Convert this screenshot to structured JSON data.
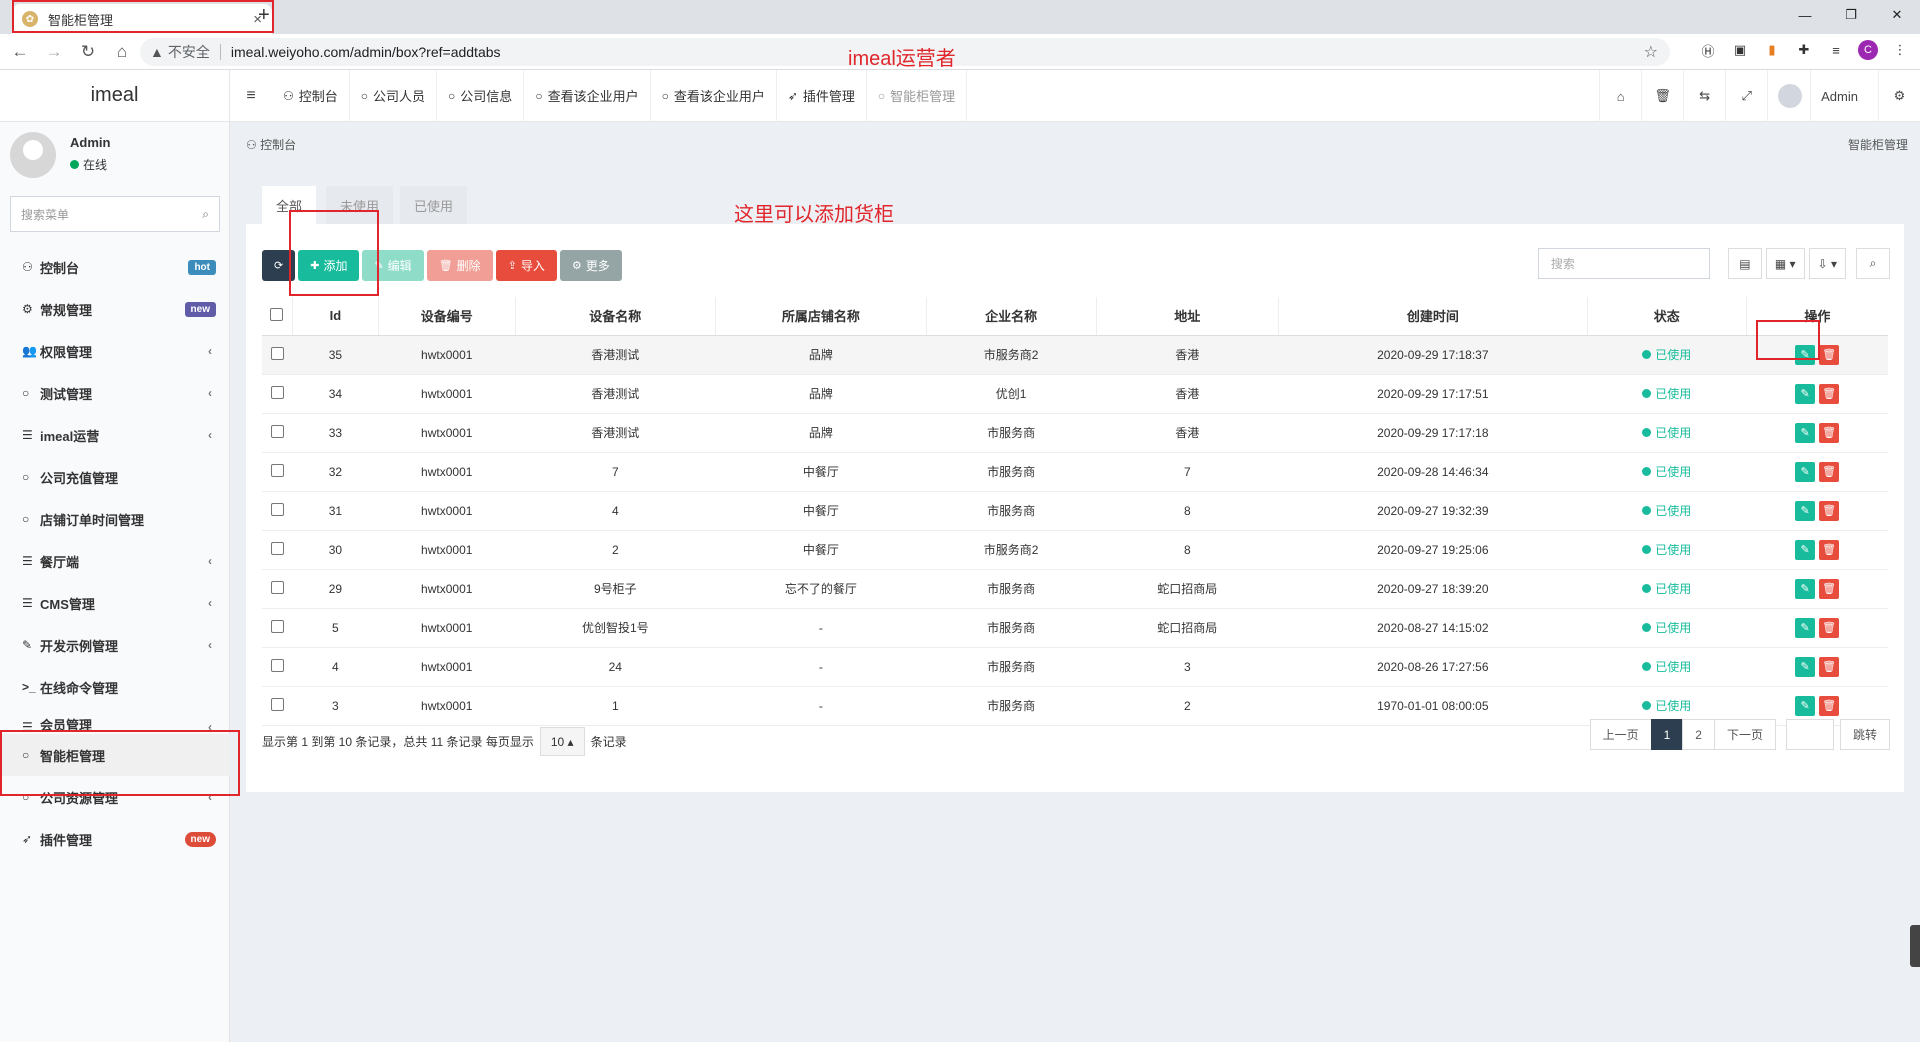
{
  "browser": {
    "tab_title": "智能柜管理",
    "tab_favicon": "imeal-favicon",
    "insecure_label": "不安全",
    "url": "imeal.weiyoho.com/admin/box?ref=addtabs",
    "profile_initial": "C"
  },
  "annotations": {
    "operator_note": "imeal运营者",
    "add_note": "这里可以添加货柜"
  },
  "brand": "imeal",
  "topnav": {
    "items": [
      {
        "icon": "dashboard-icon",
        "label": "控制台"
      },
      {
        "icon": "circle-icon",
        "label": "公司人员"
      },
      {
        "icon": "circle-icon",
        "label": "公司信息"
      },
      {
        "icon": "circle-icon",
        "label": "查看该企业用户"
      },
      {
        "icon": "circle-icon",
        "label": "查看该企业用户"
      },
      {
        "icon": "rocket-icon",
        "label": "插件管理"
      },
      {
        "icon": "circle-icon",
        "label": "智能柜管理"
      }
    ],
    "user": "Admin"
  },
  "sidebar": {
    "user_name": "Admin",
    "status": "在线",
    "search_placeholder": "搜索菜单",
    "items": [
      {
        "label": "控制台",
        "badge": "hot"
      },
      {
        "label": "常规管理",
        "badge": "new"
      },
      {
        "label": "权限管理"
      },
      {
        "label": "测试管理"
      },
      {
        "label": "imeal运营"
      },
      {
        "label": "公司充值管理"
      },
      {
        "label": "店铺订单时间管理"
      },
      {
        "label": "餐厅端"
      },
      {
        "label": "CMS管理"
      },
      {
        "label": "开发示例管理"
      },
      {
        "label": "在线命令管理"
      },
      {
        "label": "会员管理"
      },
      {
        "label": "智能柜管理"
      },
      {
        "label": "公司资源管理"
      },
      {
        "label": "插件管理",
        "badge": "new"
      }
    ]
  },
  "breadcrumb": "控制台",
  "breadcrumb_right": "智能柜管理",
  "filter_tabs": [
    "全部",
    "未使用",
    "已使用"
  ],
  "toolbar": {
    "add": "添加",
    "edit": "编辑",
    "delete": "删除",
    "import": "导入",
    "more": "更多",
    "search_placeholder": "搜索"
  },
  "table": {
    "headers": [
      "Id",
      "设备编号",
      "设备名称",
      "所属店铺名称",
      "企业名称",
      "地址",
      "创建时间",
      "状态",
      "操作"
    ],
    "rows": [
      [
        "35",
        "hwtx0001",
        "香港测试",
        "品牌",
        "市服务商2",
        "香港",
        "2020-09-29 17:18:37",
        "已使用"
      ],
      [
        "34",
        "hwtx0001",
        "香港测试",
        "品牌",
        "优创1",
        "香港",
        "2020-09-29 17:17:51",
        "已使用"
      ],
      [
        "33",
        "hwtx0001",
        "香港测试",
        "品牌",
        "市服务商",
        "香港",
        "2020-09-29 17:17:18",
        "已使用"
      ],
      [
        "32",
        "hwtx0001",
        "7",
        "中餐厅",
        "市服务商",
        "7",
        "2020-09-28 14:46:34",
        "已使用"
      ],
      [
        "31",
        "hwtx0001",
        "4",
        "中餐厅",
        "市服务商",
        "8",
        "2020-09-27 19:32:39",
        "已使用"
      ],
      [
        "30",
        "hwtx0001",
        "2",
        "中餐厅",
        "市服务商2",
        "8",
        "2020-09-27 19:25:06",
        "已使用"
      ],
      [
        "29",
        "hwtx0001",
        "9号柜子",
        "忘不了的餐厅",
        "市服务商",
        "蛇口招商局",
        "2020-09-27 18:39:20",
        "已使用"
      ],
      [
        "5",
        "hwtx0001",
        "优创智投1号",
        "-",
        "市服务商",
        "蛇口招商局",
        "2020-08-27 14:15:02",
        "已使用"
      ],
      [
        "4",
        "hwtx0001",
        "24",
        "-",
        "市服务商",
        "3",
        "2020-08-26 17:27:56",
        "已使用"
      ],
      [
        "3",
        "hwtx0001",
        "1",
        "-",
        "市服务商",
        "2",
        "1970-01-01 08:00:05",
        "已使用"
      ]
    ]
  },
  "pagination": {
    "info_prefix": "显示第 1 到第 10 条记录，总共 11 条记录 每页显示",
    "page_size": "10",
    "info_suffix": "条记录",
    "prev": "上一页",
    "pages": [
      "1",
      "2"
    ],
    "next": "下一页",
    "jump": "跳转"
  },
  "colors": {
    "primary_dark": "#2c3e50",
    "success": "#18bc9c",
    "danger": "#e74c3c",
    "annotation_red": "#e0262b"
  }
}
